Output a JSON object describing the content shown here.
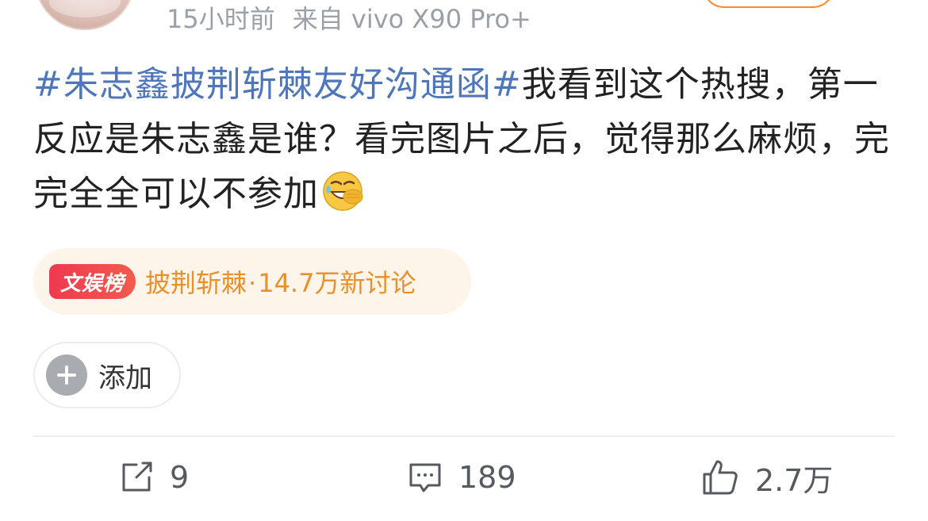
{
  "post": {
    "time": "15小时前",
    "source": "来自 vivo X90 Pro+",
    "hashtag": "#朱志鑫披荆斩棘友好沟通函#",
    "body": "我看到这个热搜，第一反应是朱志鑫是谁？看完图片之后，觉得那么麻烦，完完全全可以不参加",
    "emoji": "laugh-cry-emoji"
  },
  "topic": {
    "badge": "文娱榜",
    "name": "披荆斩棘",
    "separator": "·",
    "discussion": "14.7万新讨论"
  },
  "add_button": {
    "label": "添加"
  },
  "actions": {
    "repost_count": "9",
    "comment_count": "189",
    "like_count": "2.7万"
  },
  "colors": {
    "hashtag": "#4f76b9",
    "topic_text": "#e8902c",
    "topic_bg": "#fdf4ea",
    "badge": "#ee3a4e",
    "follow_border": "#ff8a2b"
  }
}
